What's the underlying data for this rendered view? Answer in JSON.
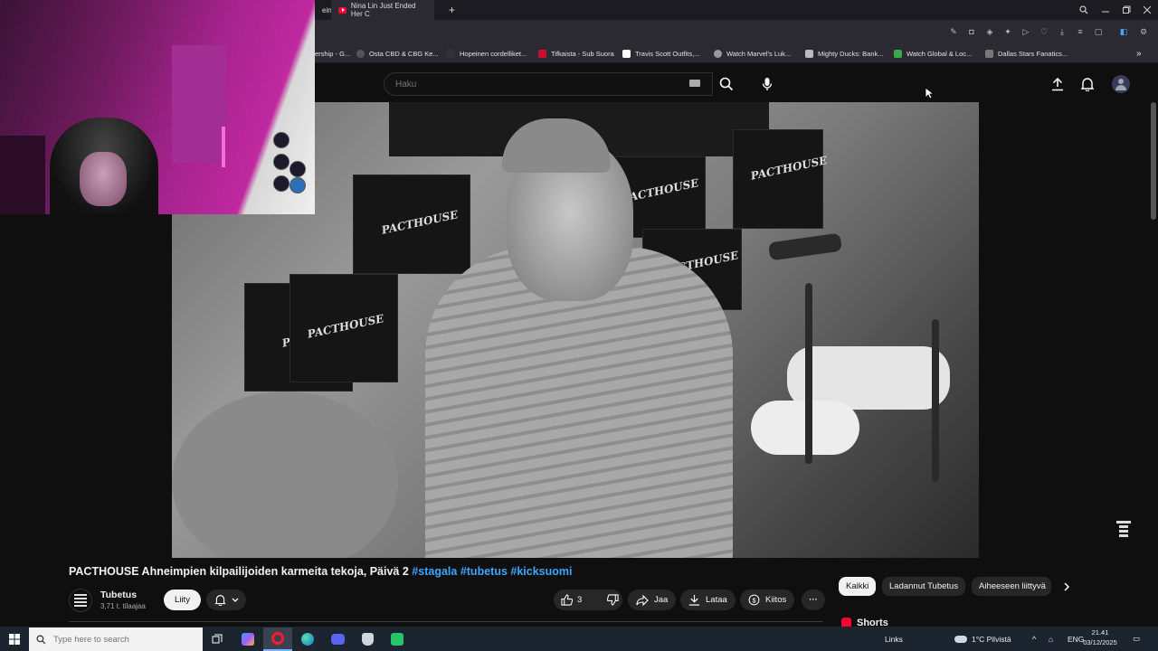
{
  "browser": {
    "tabs": [
      {
        "label": "ein"
      },
      {
        "label": "Nina Lin Just Ended Her C"
      }
    ],
    "new_tab_symbol": "+",
    "bookmarks": [
      {
        "label": "ership - G..."
      },
      {
        "label": "Osta CBD & CBG Ke..."
      },
      {
        "label": "Hopeinen cordelliket..."
      },
      {
        "label": "Tifkaista - Sub Suora"
      },
      {
        "label": "Travis Scott Outfits,..."
      },
      {
        "label": "Watch Marvel's Luk..."
      },
      {
        "label": "Mighty Ducks: Bank..."
      },
      {
        "label": "Watch Global & Loc..."
      },
      {
        "label": "Dallas Stars Fanatics..."
      }
    ]
  },
  "youtube": {
    "search_placeholder": "Haku",
    "video": {
      "title_main": "PACTHOUSE Ahneimpien kilpailijoiden karmeita tekoja, Päivä 2",
      "hashtags": [
        "#stagala",
        "#tubetus",
        "#kicksuomi"
      ],
      "box_brand": "PACTHOUSE"
    },
    "channel": {
      "name": "Tubetus",
      "subscribers": "3,71 t. tilaajaa",
      "join_label": "Liity"
    },
    "actions": {
      "like_count": "3",
      "share_label": "Jaa",
      "download_label": "Lataa",
      "thanks_label": "Kiitos",
      "more_symbol": "···"
    },
    "chips": [
      "Kaikki",
      "Ladannut Tubetus",
      "Aiheeseen liittyvä"
    ],
    "shorts_label": "Shorts"
  },
  "taskbar": {
    "search_placeholder": "Type here to search",
    "links_label": "Links",
    "weather": "1°C  Pilvistä",
    "language": "ENG",
    "time": "21.41",
    "date": "03/12/2025"
  },
  "colors": {
    "accent_link": "#3ea6ff",
    "youtube_red": "#ff0033",
    "bg": "#0f0f0f"
  }
}
